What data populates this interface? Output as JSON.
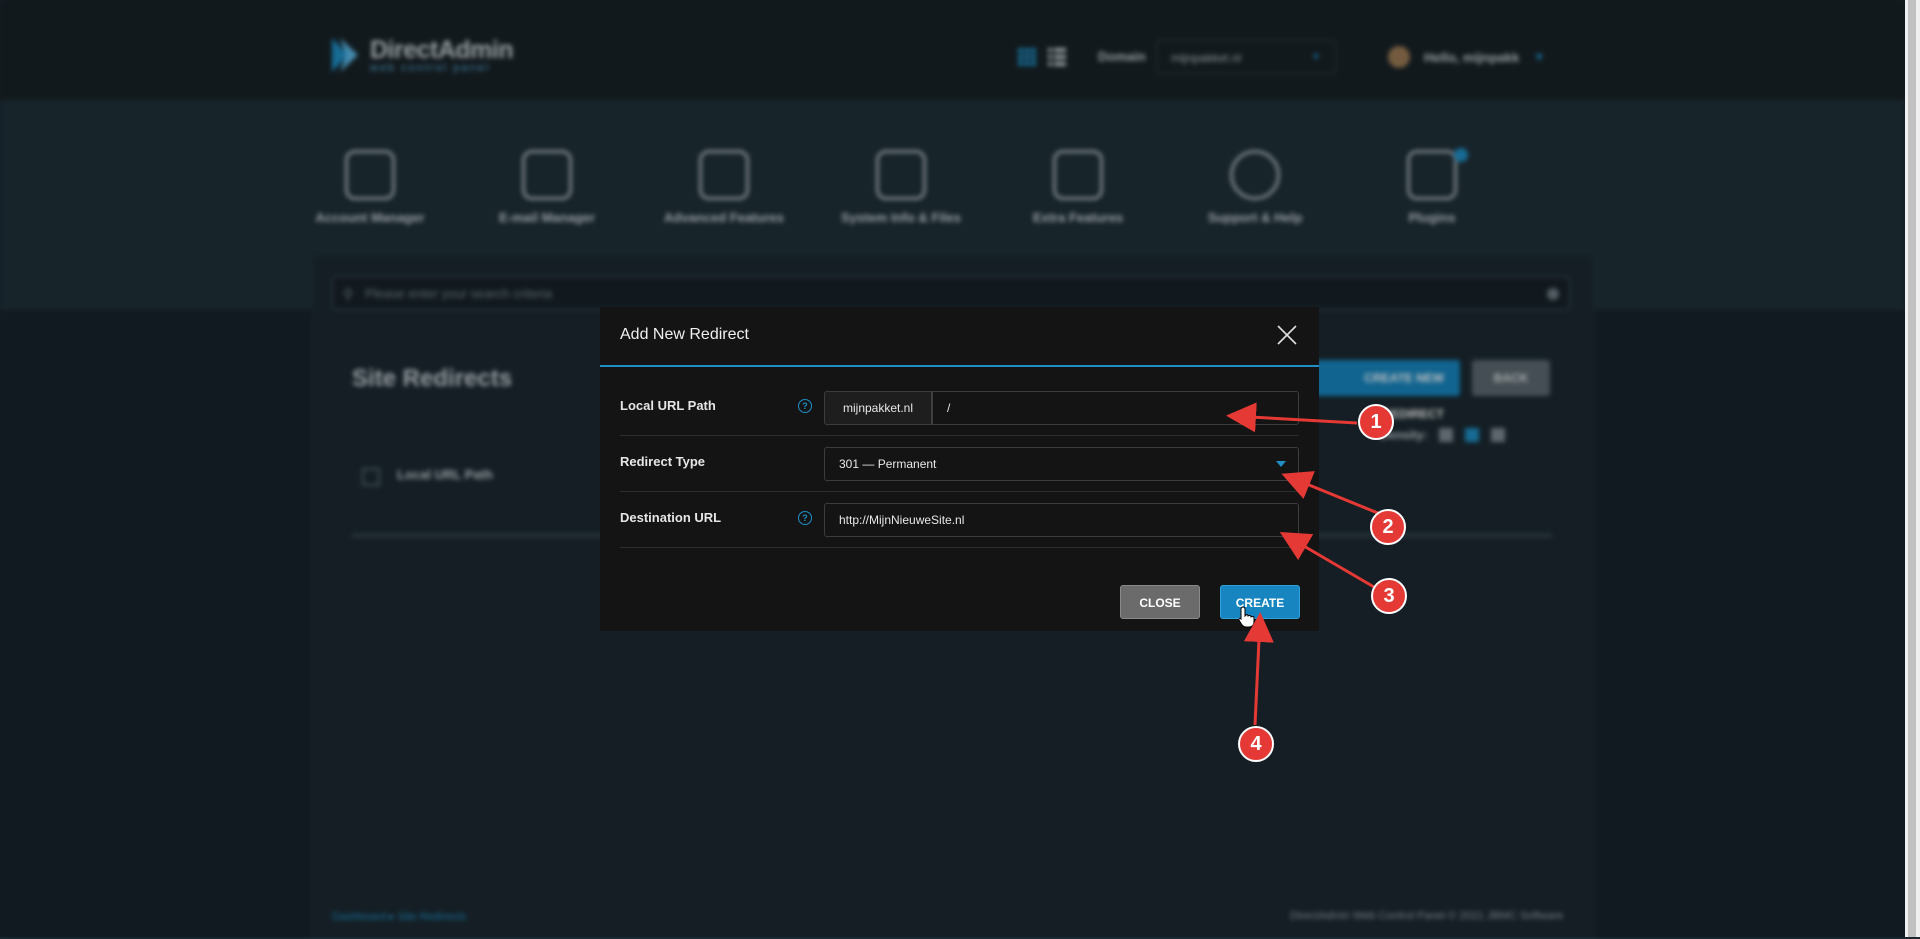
{
  "header": {
    "logo_title": "DirectAdmin",
    "logo_subtitle": "web control panel",
    "domain_label": "Domain",
    "domain_value": "mijnpakket.nl",
    "user_greeting": "Hello, mijnpakk"
  },
  "nav": [
    {
      "label": "Account Manager",
      "icon": "account-manager-icon"
    },
    {
      "label": "E-mail Manager",
      "icon": "email-icon"
    },
    {
      "label": "Advanced Features",
      "icon": "advanced-features-icon"
    },
    {
      "label": "System Info & Files",
      "icon": "folder-icon"
    },
    {
      "label": "Extra Features",
      "icon": "plus-icon"
    },
    {
      "label": "Support & Help",
      "icon": "lifebuoy-icon"
    },
    {
      "label": "Plugins",
      "icon": "puzzle-icon"
    }
  ],
  "search": {
    "placeholder": "Please enter your search criteria"
  },
  "page": {
    "title": "Site Redirects",
    "create_button": "CREATE NEW REDIRECT",
    "back_button": "BACK",
    "density_label": "Density:",
    "column_local_url": "Local URL Path"
  },
  "footer": {
    "breadcrumb": "Dashboard ▸ Site Redirects",
    "copyright": "DirectAdmin Web Control Panel © 2021 JBMC Software"
  },
  "modal": {
    "title": "Add New Redirect",
    "local_url_label": "Local URL Path",
    "local_url_domain": "mijnpakket.nl",
    "local_url_value": "/",
    "redirect_type_label": "Redirect Type",
    "redirect_type_value": "301 — Permanent",
    "destination_label": "Destination URL",
    "destination_value": "http://MijnNieuweSite.nl",
    "close_button": "CLOSE",
    "create_button": "CREATE"
  },
  "annotations": [
    "1",
    "2",
    "3",
    "4"
  ],
  "colors": {
    "accent": "#1786c0",
    "annotation": "#e53935"
  }
}
